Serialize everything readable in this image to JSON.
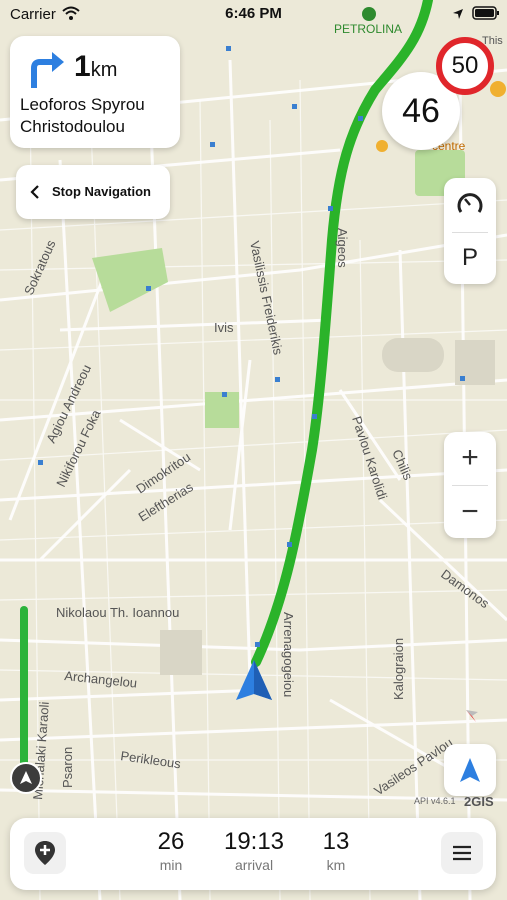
{
  "status_bar": {
    "carrier": "Carrier",
    "time": "6:46 PM"
  },
  "maneuver": {
    "distance_value": "1",
    "distance_unit": "km",
    "street": "Leoforos Spyrou Christodoulou"
  },
  "stop_navigation": {
    "label": "Stop Navigation"
  },
  "speed_limit": "50",
  "current_speed": "46",
  "side_buttons": {
    "parking_label": "P"
  },
  "zoom": {
    "in_label": "+",
    "out_label": "−"
  },
  "map_labels": {
    "poi_petrolina": "PETROLINA",
    "poi_this": "This",
    "poi_centre": "centre",
    "streets": [
      "Sokratous",
      "Vasilissis Freiderikis",
      "Aigeos",
      "Ivis",
      "Agiou Andreou",
      "Nikiforou Foka",
      "Dimokritou",
      "Eleftherias",
      "Pavlou Karolidi",
      "Chilis",
      "Damonos",
      "Nikolaou Th. Ioannou",
      "Arrenagogeiou",
      "Archangelou",
      "Kalograion",
      "Psaron",
      "Perikleous",
      "Vasileos Pavlou",
      "Michalaki Karaoli"
    ]
  },
  "attribution": "API v4.6.1",
  "logo": "2GIS",
  "trip": {
    "duration": "26",
    "duration_unit": "min",
    "arrival": "19:13",
    "arrival_label": "arrival",
    "distance": "13",
    "distance_unit": "km"
  },
  "colors": {
    "route": "#2bb32a",
    "nav_arrow": "#2d7fe0",
    "speed_limit_ring": "#e0262b",
    "map_bg": "#ece9d8"
  },
  "icons": [
    "wifi-icon",
    "location-arrow-icon",
    "battery-icon",
    "turn-right-arrow-icon",
    "chevron-left-icon",
    "speedometer-icon",
    "add-place-icon",
    "menu-icon",
    "compass-icon",
    "my-location-icon"
  ]
}
